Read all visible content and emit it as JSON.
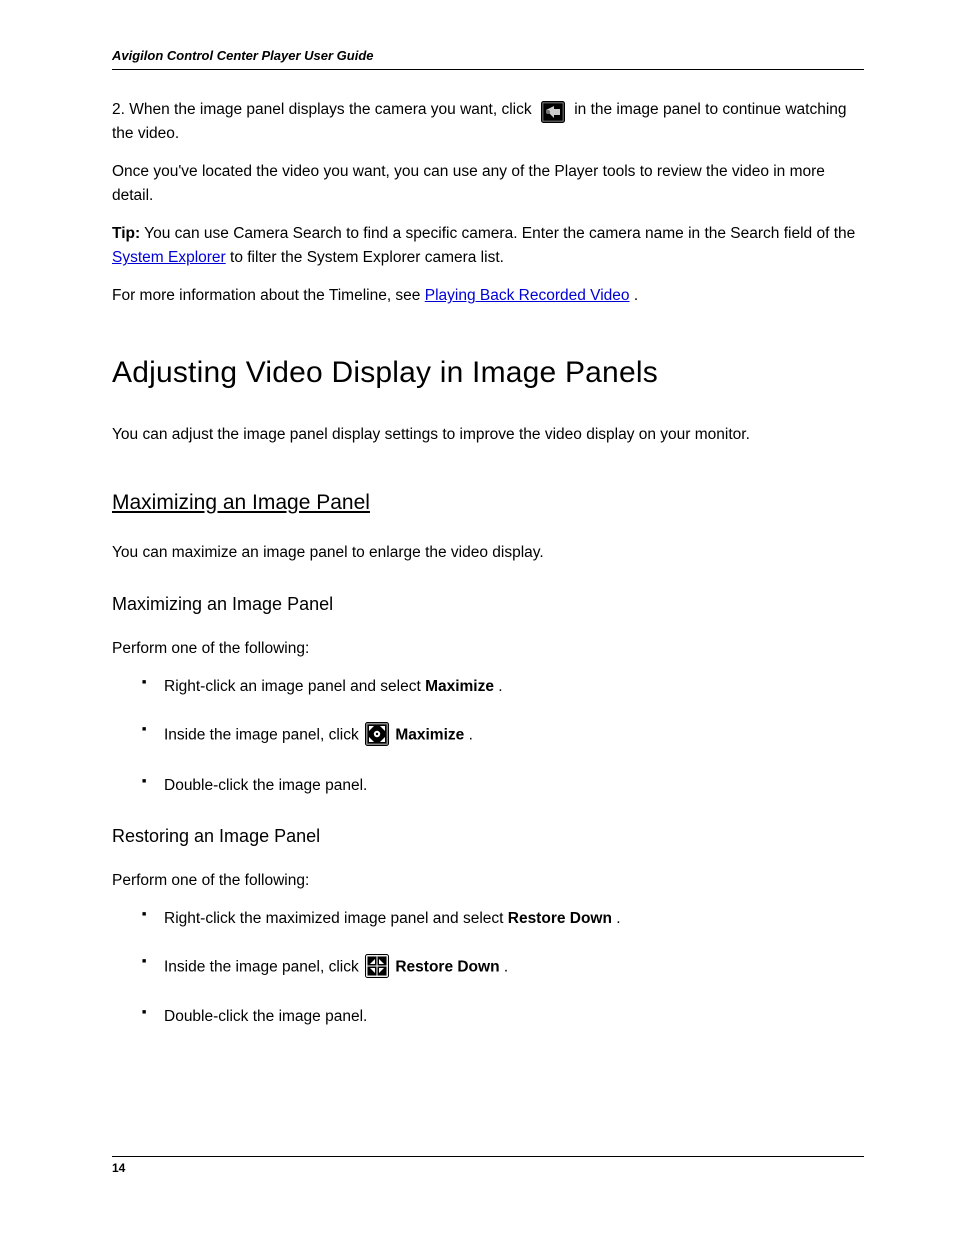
{
  "runningHeader": "Avigilon Control Center Player User Guide",
  "intro": {
    "p1_a": "2. When the image panel displays the camera you want, click ",
    "p1_b": " in the image panel to continue watching the video.",
    "p2": "Once you've located the video you want, you can use any of the Player tools to review the video in more detail.",
    "tip_lead": "Tip:",
    "tip_body": " You can use Camera Search to find a specific camera.  Enter the camera name in the Search field of the ",
    "tip_link": "System Explorer",
    "tip_after": " to filter the System Explorer camera list.",
    "p4_a": "For more information about the Timeline, see ",
    "p4_link": "Playing Back Recorded Video",
    "p4_b": "."
  },
  "h1": "Adjusting Video Display in Image Panels",
  "h1_body": "You can adjust the image panel display settings to improve the video display on your monitor.",
  "sec1": {
    "title": "Maximizing an Image Panel",
    "intro": "You can maximize an image panel to enlarge the video display.",
    "maxTitle": "Maximizing an Image Panel",
    "maxLead": "Perform one of the following:",
    "maxItems": {
      "i1_a": "Right-click an image panel and select ",
      "i1_b": "Maximize",
      "i1_c": ".",
      "i2_a": "Inside the image panel, click ",
      "i2_b": " ",
      "i2_c": "Maximize",
      "i2_d": ".",
      "i3": "Double-click the image panel."
    },
    "restTitle": "Restoring an Image Panel",
    "restLead": "Perform one of the following:",
    "restItems": {
      "i1_a": "Right-click the maximized image panel and select ",
      "i1_b": "Restore Down",
      "i1_c": ".",
      "i2_a": "Inside the image panel, click ",
      "i2_b": " ",
      "i2_c": "Restore Down",
      "i2_d": ".",
      "i3": "Double-click the image panel."
    }
  },
  "pageNumber": "14"
}
